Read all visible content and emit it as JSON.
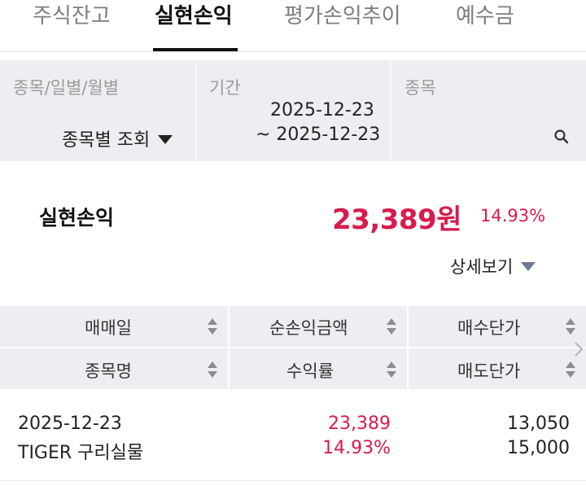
{
  "tabs": [
    {
      "label": "주식잔고",
      "active": false
    },
    {
      "label": "실현손익",
      "active": true
    },
    {
      "label": "평가손익추이",
      "active": false
    },
    {
      "label": "예수금",
      "active": false
    }
  ],
  "filter": {
    "type_label": "종목/일별/월별",
    "type_value": "종목별 조회",
    "period_label": "기간",
    "period_start": "2025-12-23",
    "period_end": "~ 2025-12-23",
    "stock_label": "종목"
  },
  "summary": {
    "title": "실현손익",
    "amount": "23,389원",
    "rate": "14.93%",
    "detail_label": "상세보기"
  },
  "table": {
    "headers_row1": [
      "매매일",
      "순손익금액",
      "매수단가"
    ],
    "headers_row2": [
      "종목명",
      "수익률",
      "매도단가"
    ],
    "rows": [
      {
        "date": "2025-12-23",
        "name": "TIGER 구리실물",
        "net_profit": "23,389",
        "rate": "14.93%",
        "buy_price": "13,050",
        "sell_price": "15,000"
      }
    ]
  },
  "colors": {
    "accent_red": "#d81b4f",
    "panel_bg": "#eceef1"
  }
}
